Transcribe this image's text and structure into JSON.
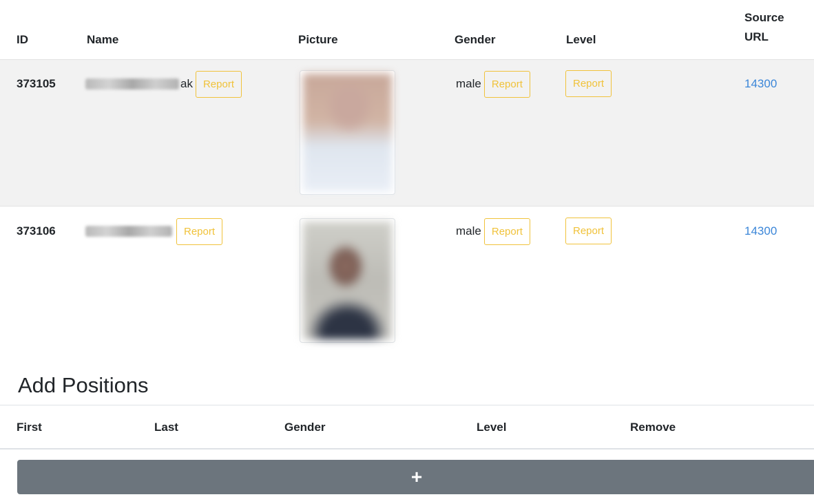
{
  "people_table": {
    "headers": {
      "id": "ID",
      "name": "Name",
      "picture": "Picture",
      "gender": "Gender",
      "level": "Level",
      "source_url_line1": "Source",
      "source_url_line2": "URL"
    },
    "rows": [
      {
        "id": "373105",
        "name_visible_suffix": "ak",
        "report_label": "Report",
        "gender": "male",
        "gender_report_label": "Report",
        "level_report_label": "Report",
        "source_link": "14300"
      },
      {
        "id": "373106",
        "name_visible_suffix": "",
        "report_label": "Report",
        "gender": "male",
        "gender_report_label": "Report",
        "level_report_label": "Report",
        "source_link": "14300"
      }
    ]
  },
  "positions": {
    "title": "Add Positions",
    "headers": {
      "first": "First",
      "last": "Last",
      "gender": "Gender",
      "level": "Level",
      "remove": "Remove"
    },
    "add_button_label": "+"
  },
  "colors": {
    "row_highlight": "#f2f2f2",
    "report_warning": "#f0c23a",
    "link": "#3b86d8",
    "add_button": "#6c757d"
  }
}
